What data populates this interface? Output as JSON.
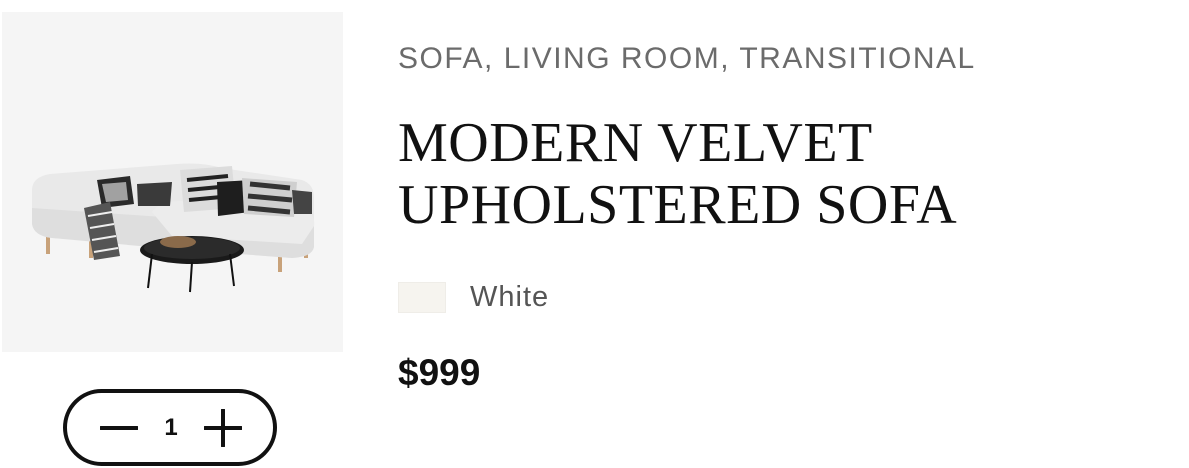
{
  "product": {
    "categories": "SOFA, LIVING ROOM, TRANSITIONAL",
    "title_line1": "MODERN VELVET",
    "title_line2": "UPHOLSTERED SOFA",
    "variant": {
      "label": "White",
      "swatch_color": "#f6f4ef"
    },
    "price": "$999",
    "image_alt": "White sectional sofa with patterned pillows and round black coffee table"
  },
  "quantity": {
    "value": "1",
    "decrement_icon": "minus-icon",
    "increment_icon": "plus-icon"
  }
}
